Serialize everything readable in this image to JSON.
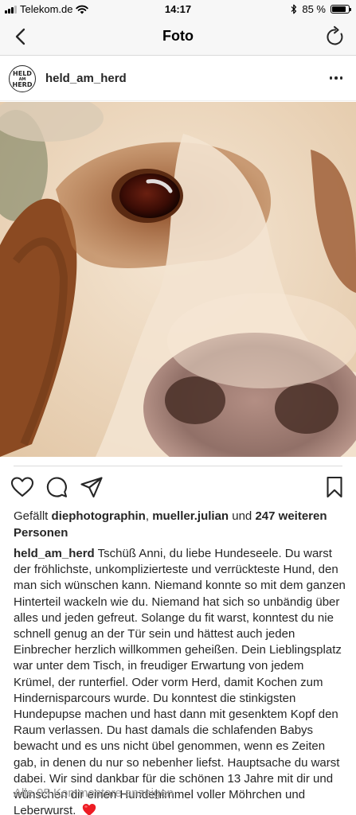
{
  "status_bar": {
    "carrier": "Telekom.de",
    "time": "14:17",
    "battery_percent_label": "85 %",
    "battery_level": 0.85
  },
  "nav": {
    "title": "Foto",
    "back_icon": "chevron-left-icon",
    "refresh_icon": "refresh-icon"
  },
  "post": {
    "username": "held_am_herd",
    "avatar_logo_lines": [
      "HELD",
      "AM",
      "HERD"
    ],
    "more_icon": "ellipsis-icon"
  },
  "actions": {
    "like_icon": "heart-icon",
    "comment_icon": "comment-icon",
    "share_icon": "paper-plane-icon",
    "save_icon": "bookmark-icon"
  },
  "likes": {
    "prefix": "Gefällt ",
    "user1": "diephotographin",
    "separator": ", ",
    "user2": "mueller.julian",
    "middle": " und ",
    "others": "247 weiteren Personen"
  },
  "caption": {
    "username": "held_am_herd",
    "text": "Tschüß Anni, du liebe Hundeseele. Du warst der fröhlichste, unkomplizierteste und verrückteste Hund, den man sich wünschen kann. Niemand konnte so mit dem ganzen Hinterteil wackeln wie du. Niemand hat sich so unbändig über alles und jeden gefreut. Solange du fit warst, konntest du nie schnell genug an der Tür sein und hättest auch jeden Einbrecher herzlich willkommen geheißen. Dein Lieblingsplatz war unter dem Tisch, in freudiger Erwartung von jedem Krümel, der runterfiel. Oder vorm Herd, damit Kochen zum Hindernisparcours wurde. Du konntest die stinkigsten Hundepupse machen und hast dann mit gesenktem Kopf den Raum verlassen. Du hast damals die schlafenden Babys bewacht und es uns nicht übel genommen, wenn es Zeiten gab, in denen du nur so nebenher liefst. Hauptsache du warst dabei. Wir sind dankbar für die schönen 13 Jahre mit dir und wünschen dir einen Hundehimmel voller Möhrchen und Leberwurst.",
    "emoji": "red-heart-emoji"
  },
  "comments": {
    "view_all": "Alle 95 Kommentare anzeigen"
  },
  "colors": {
    "text": "#262626",
    "muted": "#999999",
    "bar_bg": "#f7f7f7",
    "divider": "#dbdbdb",
    "heart": "#ed1c24"
  }
}
